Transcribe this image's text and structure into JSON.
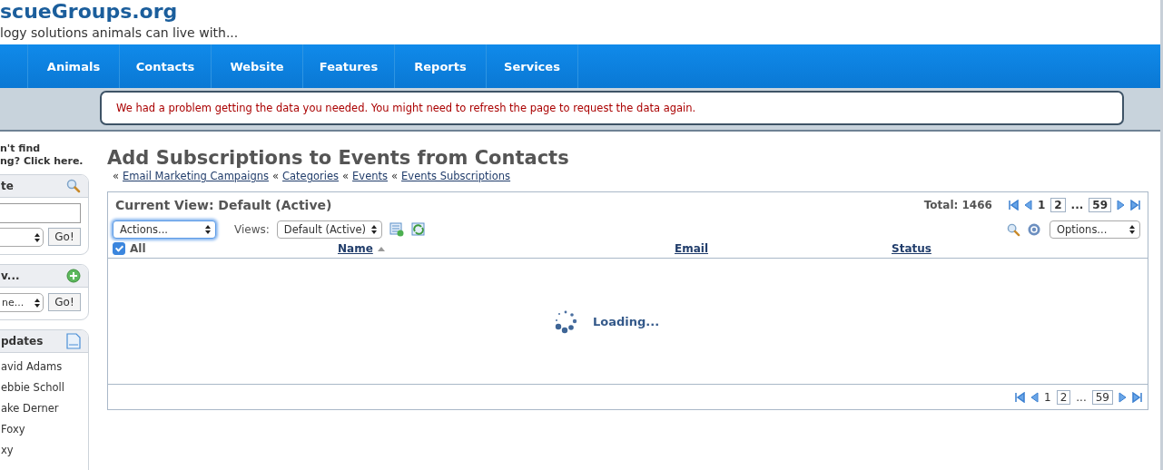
{
  "header": {
    "logo": "scueGroups.org",
    "tagline": "logy solutions animals can live with..."
  },
  "nav": {
    "items": [
      "Animals",
      "Contacts",
      "Website",
      "Features",
      "Reports",
      "Services"
    ]
  },
  "alert": {
    "text": "We had a problem getting the data you needed. You might need to refresh the page to request the data again."
  },
  "sidebar": {
    "help_lines": [
      "n't find",
      "ng? Click here."
    ],
    "panels": [
      {
        "kind": "search",
        "title": "te",
        "button": "Go!"
      },
      {
        "kind": "new",
        "title": "v...",
        "select": "ne...",
        "button": "Go!"
      },
      {
        "kind": "updates",
        "title": "pdates",
        "items": [
          "avid Adams",
          "ebbie Scholl",
          "ake Derner",
          "Foxy",
          "xy"
        ]
      }
    ]
  },
  "main": {
    "title": "Add Subscriptions to Events from Contacts",
    "breadcrumbs": [
      {
        "sep": "«",
        "label": "Email Marketing Campaigns"
      },
      {
        "sep": "«",
        "label": "Categories"
      },
      {
        "sep": "«",
        "label": "Events"
      },
      {
        "sep": "«",
        "label": "Events Subscriptions"
      }
    ],
    "grid": {
      "view_title": "Current View: Default (Active)",
      "total": "Total: 1466",
      "pager_top": {
        "pages": [
          {
            "label": "1",
            "selected": true
          },
          {
            "label": "2",
            "selected": false
          }
        ],
        "ellipsis": "...",
        "last": "59"
      },
      "actions_select": {
        "value": "Actions...",
        "focused": true
      },
      "views_label": "Views:",
      "views_select": "Default (Active)",
      "options_select": "Options...",
      "columns": [
        {
          "kind": "checkbox",
          "label": "All",
          "checked": true
        },
        {
          "kind": "sort",
          "label": "Name",
          "sorted": true
        },
        {
          "kind": "sort",
          "label": "Email"
        },
        {
          "kind": "sort",
          "label": "Status"
        }
      ],
      "loading": "Loading...",
      "pager_bottom": {
        "pages": [
          {
            "label": "1",
            "selected": true
          },
          {
            "label": "2",
            "selected": false
          }
        ],
        "ellipsis": "...",
        "last": "59"
      }
    }
  }
}
